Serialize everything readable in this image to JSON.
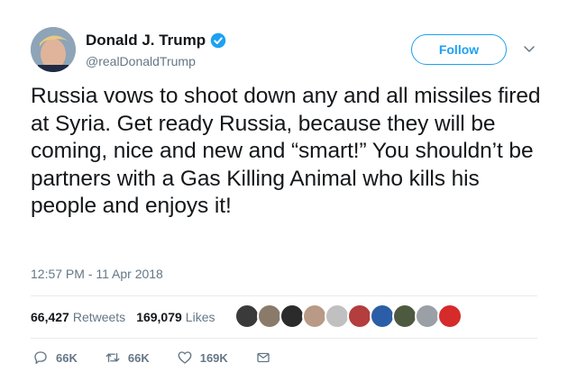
{
  "author": {
    "display_name": "Donald J. Trump",
    "handle": "@realDonaldTrump",
    "verified": true
  },
  "follow_label": "Follow",
  "tweet_text": "Russia vows to shoot down any and all missiles fired at Syria. Get ready Russia, because they will be coming, nice and new and “smart!” You shouldn’t be partners with a Gas Killing Animal who kills his people and enjoys it!",
  "timestamp": "12:57 PM - 11 Apr 2018",
  "stats": {
    "retweets_count": "66,427",
    "retweets_label": "Retweets",
    "likes_count": "169,079",
    "likes_label": "Likes"
  },
  "liker_avatar_colors": [
    "#3a3a3a",
    "#8a7a6a",
    "#2b2b2b",
    "#b89a86",
    "#c0c0c0",
    "#b43d3d",
    "#2c5ea8",
    "#4e5a3f",
    "#9aa0a6",
    "#d62b2b"
  ],
  "actions": {
    "reply_count": "66K",
    "retweet_count": "66K",
    "like_count": "169K"
  },
  "colors": {
    "accent": "#1da1f2",
    "secondary_text": "#657786",
    "divider": "#e6ecf0"
  }
}
